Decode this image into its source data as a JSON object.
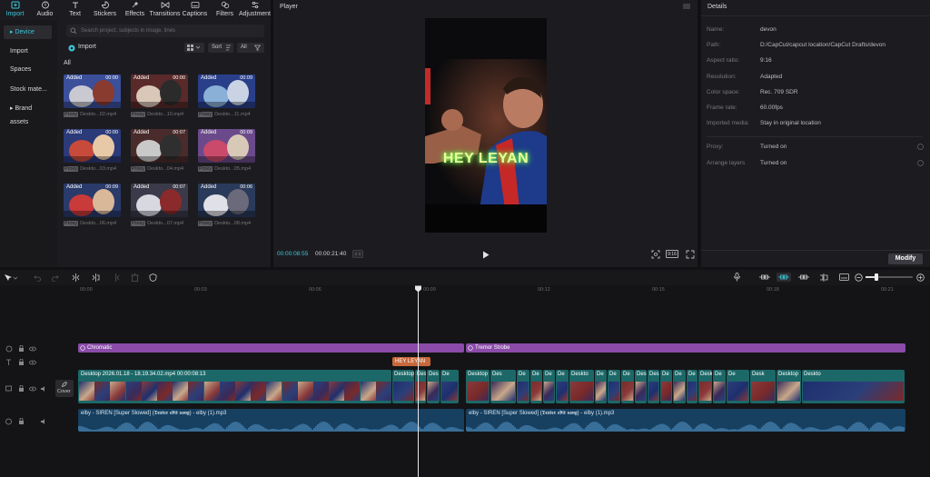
{
  "toolbar": {
    "tabs": [
      {
        "label": "Import",
        "icon": "import-icon",
        "active": true
      },
      {
        "label": "Audio",
        "icon": "audio-icon"
      },
      {
        "label": "Text",
        "icon": "text-icon"
      },
      {
        "label": "Stickers",
        "icon": "stickers-icon"
      },
      {
        "label": "Effects",
        "icon": "effects-icon"
      },
      {
        "label": "Transitions",
        "icon": "transitions-icon"
      },
      {
        "label": "Captions",
        "icon": "captions-icon"
      },
      {
        "label": "Filters",
        "icon": "filters-icon"
      },
      {
        "label": "Adjustment",
        "icon": "adjustment-icon"
      }
    ]
  },
  "sidebar": {
    "items": [
      {
        "label": "▸ Device",
        "active": true
      },
      {
        "label": "Import"
      },
      {
        "label": "Spaces"
      },
      {
        "label": "Stock mate..."
      },
      {
        "label": "▸ Brand assets"
      }
    ]
  },
  "media": {
    "search_placeholder": "Search project, subjects in image, lines",
    "import_label": "Import",
    "sort_label": "Sort",
    "all_label": "All",
    "all_heading": "All",
    "proxy_label": "Proxy",
    "items": [
      {
        "badge": "Added",
        "duration": "00:00",
        "name": "Deskto...02.mp4"
      },
      {
        "badge": "Added",
        "duration": "00:00",
        "name": "Deskto...10.mp4"
      },
      {
        "badge": "Added",
        "duration": "00:09",
        "name": "Deskto...11.mp4"
      },
      {
        "badge": "Added",
        "duration": "00:00",
        "name": "Deskto...03.mp4"
      },
      {
        "badge": "Added",
        "duration": "00:07",
        "name": "Deskto...04.mp4"
      },
      {
        "badge": "Added",
        "duration": "00:09",
        "name": "Deskto...05.mp4"
      },
      {
        "badge": "Added",
        "duration": "00:09",
        "name": "Deskto...06.mp4"
      },
      {
        "badge": "Added",
        "duration": "00:07",
        "name": "Deskto...07.mp4"
      },
      {
        "badge": "Added",
        "duration": "00:06",
        "name": "Deskto...08.mp4"
      }
    ]
  },
  "player": {
    "title": "Player",
    "caption": "HEY LEYAN",
    "current_time": "00:00:08:55",
    "total_time": "00:00:21:40",
    "ratio_label": "9:16"
  },
  "details": {
    "title": "Details",
    "rows": [
      {
        "label": "Name:",
        "value": "devon"
      },
      {
        "label": "Path:",
        "value": "D:/CapCut/capcut location/CapCut Drafts/devon"
      },
      {
        "label": "Aspect ratio:",
        "value": "9:16"
      },
      {
        "label": "Resolution:",
        "value": "Adapted"
      },
      {
        "label": "Color space:",
        "value": "Rec. 709 SDR"
      },
      {
        "label": "Frame rate:",
        "value": "60.00fps"
      },
      {
        "label": "Imported media:",
        "value": "Stay in original location"
      }
    ],
    "extra_rows": [
      {
        "label": "Proxy:",
        "value": "Turned on"
      },
      {
        "label": "Arrange layers",
        "value": "Turned on"
      }
    ],
    "modify_label": "Modify"
  },
  "timeline": {
    "ticks": [
      "00:00",
      "00:03",
      "00:06",
      "00:09",
      "00:12",
      "00:15",
      "00:18",
      "00:21"
    ],
    "effect_clips": [
      "Chromatic",
      "Tremor Strobe"
    ],
    "text_clip": "HEY LEYAN",
    "main_clip_label": "Desktop 2026.01.18 - 18.19.34.02.mp4   00:00:08:13",
    "cover_label": "Cover",
    "small_clip_labels": [
      "Desktop 20",
      "Des",
      "Des",
      "De",
      "Desktop",
      "Des",
      "De",
      "De",
      "De",
      "De",
      "Deskto",
      "De",
      "De",
      "De",
      "Desktop",
      "Deskto",
      "De",
      "De",
      "De",
      "Deskt",
      "De",
      "De",
      "Desk",
      "Desktop",
      "Deskto"
    ],
    "audio_clip_1": "elby - SIREN [Super Slowed] (𝕯𝖊𝖝𝖙𝖊𝖗 𝖊𝖉𝖎𝖙 𝖘𝖔𝖓𝖌) - elby (1).mp3",
    "audio_clip_2": "elby - SIREN [Super Slowed] (𝕯𝖊𝖝𝖙𝖊𝖗 𝖊𝖉𝖎𝖙 𝖘𝖔𝖓𝖌) - elby (1).mp3"
  },
  "colors": {
    "accent": "#3cc6d8",
    "effect_track": "#8e4fa8",
    "text_clip": "#c76a3d",
    "video_clip": "#1f6e6e",
    "audio_clip": "#1a4a6e"
  }
}
